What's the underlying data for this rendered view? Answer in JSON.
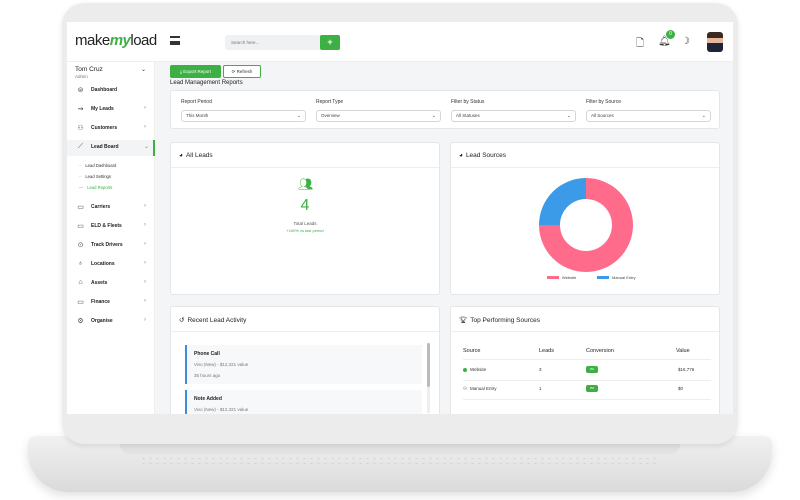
{
  "brand": {
    "logo_pre": "make",
    "logo_my": "my",
    "logo_post": "load",
    "accent": "#3cb043"
  },
  "header": {
    "search_placeholder": "Search here...",
    "add_label": "+",
    "notification_count": "0"
  },
  "user": {
    "name": "Tom Cruz",
    "role": "Admin"
  },
  "sidebar": {
    "items": [
      {
        "label": "Dashboard",
        "icon": "dashboard-icon",
        "glyph": "⊜",
        "arrow": ""
      },
      {
        "label": "My Leads",
        "icon": "leads-icon",
        "glyph": "⇝",
        "arrow": "›"
      },
      {
        "label": "Customers",
        "icon": "customers-icon",
        "glyph": "⚇",
        "arrow": "›"
      },
      {
        "label": "Lead Board",
        "icon": "chart-icon",
        "glyph": "⟋",
        "arrow": "⌄"
      },
      {
        "label": "Carriers",
        "icon": "truck-icon",
        "glyph": "▭",
        "arrow": "›"
      },
      {
        "label": "ELD & Fleets",
        "icon": "fleet-icon",
        "glyph": "▭",
        "arrow": "›"
      },
      {
        "label": "Track Drivers",
        "icon": "location-pin-icon",
        "glyph": "⊙",
        "arrow": "›"
      },
      {
        "label": "Locations",
        "icon": "map-pin-icon",
        "glyph": "♁",
        "arrow": "›"
      },
      {
        "label": "Assets",
        "icon": "box-icon",
        "glyph": "⌂",
        "arrow": "›"
      },
      {
        "label": "Finance",
        "icon": "wallet-icon",
        "glyph": "▭",
        "arrow": "›"
      },
      {
        "label": "Organise",
        "icon": "settings-icon",
        "glyph": "⚙",
        "arrow": "›"
      }
    ],
    "sub_items": [
      "Lead Dashboard",
      "Lead Settings",
      "Lead Reports"
    ]
  },
  "toolbar": {
    "export_label": "⤓ Export Report",
    "refresh_label": "⟳ Refresh"
  },
  "page_title": "Lead Management Reports",
  "filters": [
    {
      "label": "Report Period",
      "value": "This Month"
    },
    {
      "label": "Report Type",
      "value": "Overview"
    },
    {
      "label": "Filter by Status",
      "value": "All Statuses"
    },
    {
      "label": "Filter by Source",
      "value": "All Sources"
    }
  ],
  "all_leads": {
    "title": "All Leads",
    "count": "4",
    "label": "Total Leads",
    "change": "+100% vs last period"
  },
  "lead_sources": {
    "title": "Lead Sources",
    "legend": [
      {
        "name": "Website",
        "color": "#ff6b8a"
      },
      {
        "name": "Manual Entry",
        "color": "#3c9be8"
      }
    ]
  },
  "chart_data": {
    "type": "pie",
    "categories": [
      "Website",
      "Manual Entry"
    ],
    "values": [
      3,
      1
    ],
    "colors": [
      "#ff6b8a",
      "#3c9be8"
    ],
    "title": "Lead Sources",
    "donut": true
  },
  "recent_activity": {
    "title": "Recent Lead Activity",
    "items": [
      {
        "title": "Phone Call",
        "value": "Vivo (New) - $12,321 value",
        "time": "35 hours ago"
      },
      {
        "title": "Note Added",
        "value": "Vivo (New) - $12,321 value",
        "time": ""
      }
    ]
  },
  "top_sources": {
    "title": "Top Performing Sources",
    "columns": [
      "Source",
      "Leads",
      "Conversion",
      "Value"
    ],
    "rows": [
      {
        "source": "Website",
        "leads": "3",
        "conversion": "0%",
        "value": "$16,776"
      },
      {
        "source": "Manual Entry",
        "leads": "1",
        "conversion": "0%",
        "value": "$0"
      }
    ]
  }
}
